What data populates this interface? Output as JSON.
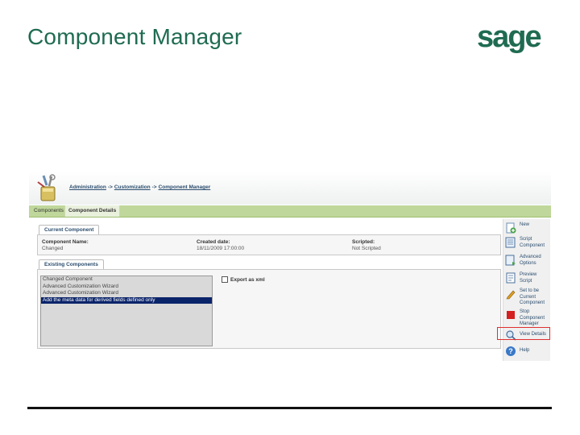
{
  "slide": {
    "title": "Component Manager",
    "logo_text": "sage"
  },
  "breadcrumb": {
    "items": [
      "Administration",
      "Customization",
      "Component Manager"
    ],
    "separator": "->"
  },
  "tabs": {
    "components": "Components",
    "component_details": "Component Details"
  },
  "current_component": {
    "tab_label": "Current Component",
    "name_label": "Component Name:",
    "name_value": "Changed",
    "created_label": "Created date:",
    "created_value": "18/11/2009 17:00:00",
    "scripted_label": "Scripted:",
    "scripted_value": "Not Scripted"
  },
  "existing_components": {
    "tab_label": "Existing Components",
    "items": [
      "Changed Component",
      "Advanced Customization Wizard",
      "Advanced Customization Wizard",
      "Add the meta data for derived fields defined only"
    ],
    "selected_index": 3,
    "export_label": "Export as xml",
    "export_checked": false
  },
  "actions": [
    {
      "label": "New",
      "icon": "new-doc-icon"
    },
    {
      "label": "Script Component",
      "icon": "script-icon"
    },
    {
      "label": "Advanced Options",
      "icon": "advanced-options-icon"
    },
    {
      "label": "Preview Script",
      "icon": "preview-icon"
    },
    {
      "label": "Set to be Current Component",
      "icon": "pencil-icon"
    },
    {
      "label": "Stop Component Manager",
      "icon": "stop-icon"
    },
    {
      "label": "View Details",
      "icon": "magnifier-icon"
    },
    {
      "label": "Help",
      "icon": "help-icon"
    }
  ],
  "colors": {
    "title": "#1f6b52",
    "brand": "#1f6b52",
    "tabbar": "#bfd79a",
    "selection": "#0a246a",
    "highlight": "#e03030"
  }
}
